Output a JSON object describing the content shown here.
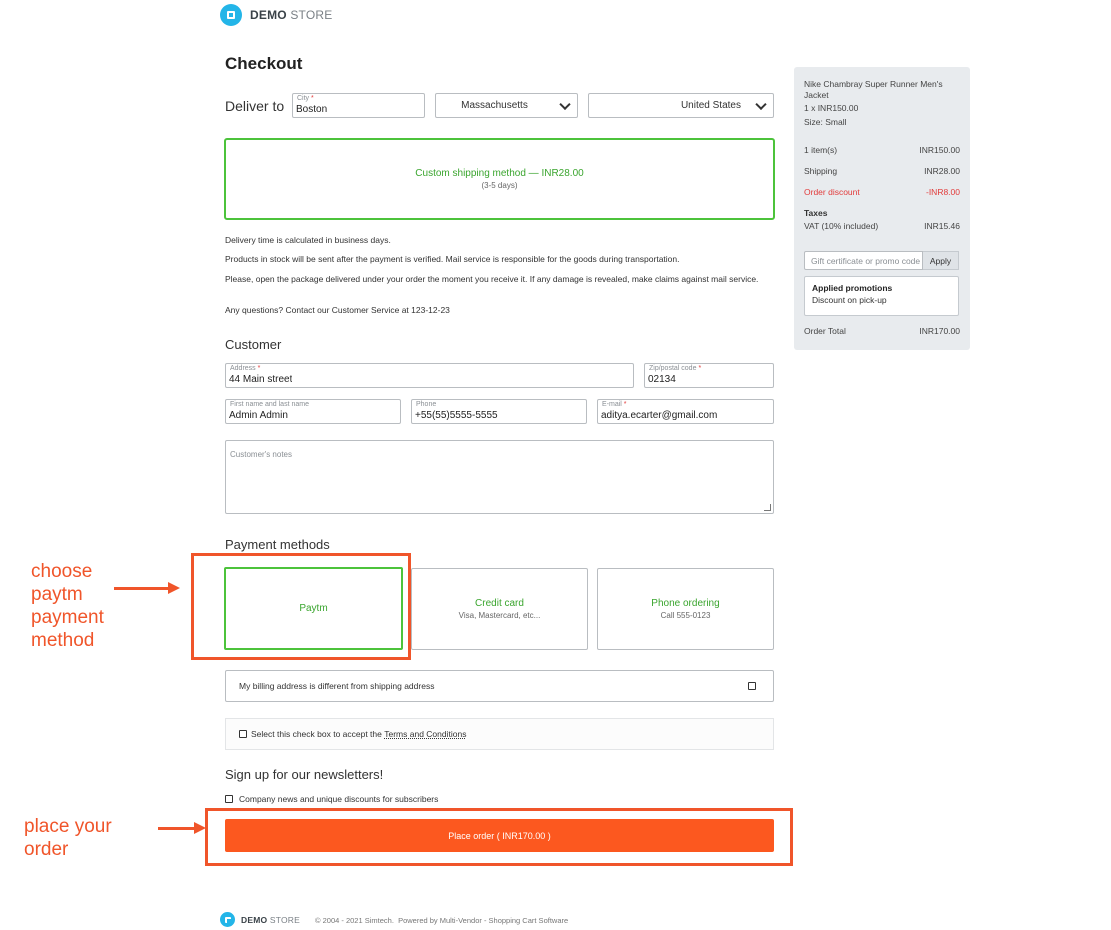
{
  "header": {
    "logo_bold": "DEMO",
    "logo_light": " STORE"
  },
  "checkout": {
    "title": "Checkout",
    "deliver_to_label": "Deliver to",
    "city": {
      "label": "City",
      "value": "Boston"
    },
    "state": {
      "value": "Massachusetts"
    },
    "country": {
      "value": "United States"
    }
  },
  "shipping": {
    "method": "Custom shipping method — INR28.00",
    "time": "(3-5 days)"
  },
  "info": {
    "line1": "Delivery time is calculated in business days.",
    "line2": "Products in stock will be sent after the payment is verified. Mail service is responsible for the goods during transportation.",
    "line3": "Please, open the package delivered under your order the moment you receive it. If any damage is revealed, make claims against mail service.",
    "line4": "Any questions? Contact our Customer Service at 123-12-23"
  },
  "customer": {
    "title": "Customer",
    "address": {
      "label": "Address",
      "value": "44 Main street"
    },
    "zip": {
      "label": "Zip/postal code",
      "value": "02134"
    },
    "name": {
      "label": "First name and last name",
      "value": "Admin Admin"
    },
    "phone": {
      "label": "Phone",
      "value": "+55(55)5555-5555"
    },
    "email": {
      "label": "E-mail",
      "value": "aditya.ecarter@gmail.com"
    },
    "notes_placeholder": "Customer's notes"
  },
  "payment": {
    "title": "Payment methods",
    "methods": [
      {
        "name": "Paytm",
        "sub": ""
      },
      {
        "name": "Credit card",
        "sub": "Visa, Mastercard, etc..."
      },
      {
        "name": "Phone ordering",
        "sub": "Call 555-0123"
      }
    ]
  },
  "billing": {
    "label": "My billing address is different from shipping address"
  },
  "terms": {
    "prefix": "Select this check box to accept the ",
    "link": "Terms and Conditions"
  },
  "newsletter": {
    "title": "Sign up for our newsletters!",
    "option": "Company news and unique discounts for subscribers"
  },
  "place_order": {
    "label": "Place order ( INR170.00 )"
  },
  "annotations": {
    "choose_paytm": [
      "choose",
      "paytm",
      "payment",
      "method"
    ],
    "place_order": [
      "place your",
      "order"
    ]
  },
  "summary": {
    "product_name": "Nike Chambray Super Runner Men's Jacket",
    "product_qty_price": "1 x INR150.00",
    "product_size": "Size: Small",
    "items_label": "1 item(s)",
    "items_value": "INR150.00",
    "shipping_label": "Shipping",
    "shipping_value": "INR28.00",
    "discount_label": "Order discount",
    "discount_value": "-INR8.00",
    "taxes_title": "Taxes",
    "vat_label": "VAT (10% included)",
    "vat_value": "INR15.46",
    "promo_placeholder": "Gift certificate or promo code",
    "apply_label": "Apply",
    "promotions_title": "Applied promotions",
    "promotion_item": "Discount on pick-up",
    "total_label": "Order Total",
    "total_value": "INR170.00"
  },
  "footer": {
    "logo_bold": "DEMO",
    "logo_light": " STORE",
    "copyright": "© 2004 - 2021 Simtech.  Powered by Multi-Vendor - Shopping Cart Software"
  },
  "colors": {
    "accent_green": "#4cc33b",
    "place_order_orange": "#fc581f",
    "annotation_red": "#f0552a",
    "logo_blue": "#23b5e8"
  }
}
